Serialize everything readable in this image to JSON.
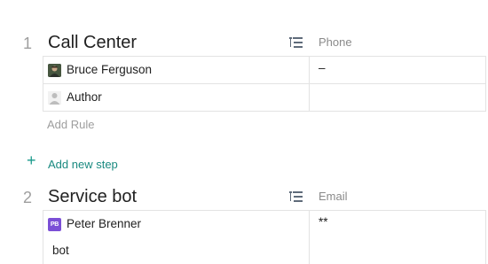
{
  "steps": [
    {
      "number": "1",
      "title": "Call Center",
      "field_header": "Phone",
      "rows": [
        {
          "assignee": "Bruce Ferguson",
          "avatar_type": "photo",
          "value": "–"
        },
        {
          "assignee": "Author",
          "avatar_type": "placeholder",
          "value": ""
        }
      ],
      "add_rule_label": "Add Rule"
    },
    {
      "number": "2",
      "title": "Service bot",
      "field_header": "Email",
      "rows": [
        {
          "assignee": "Peter Brenner",
          "avatar_type": "initials",
          "avatar_initials": "PB",
          "value": "**"
        },
        {
          "text": "bot"
        }
      ]
    }
  ],
  "add_step": {
    "icon": "plus-icon",
    "label": "Add new step"
  },
  "icons": {
    "rules": "rules-list-icon",
    "avatar_placeholder": "user-silhouette-icon"
  },
  "colors": {
    "accent": "#1a9a8c",
    "initials_avatar": "#7b4fd6",
    "muted_text": "#9e9e9e",
    "border": "#e3e3e3"
  }
}
